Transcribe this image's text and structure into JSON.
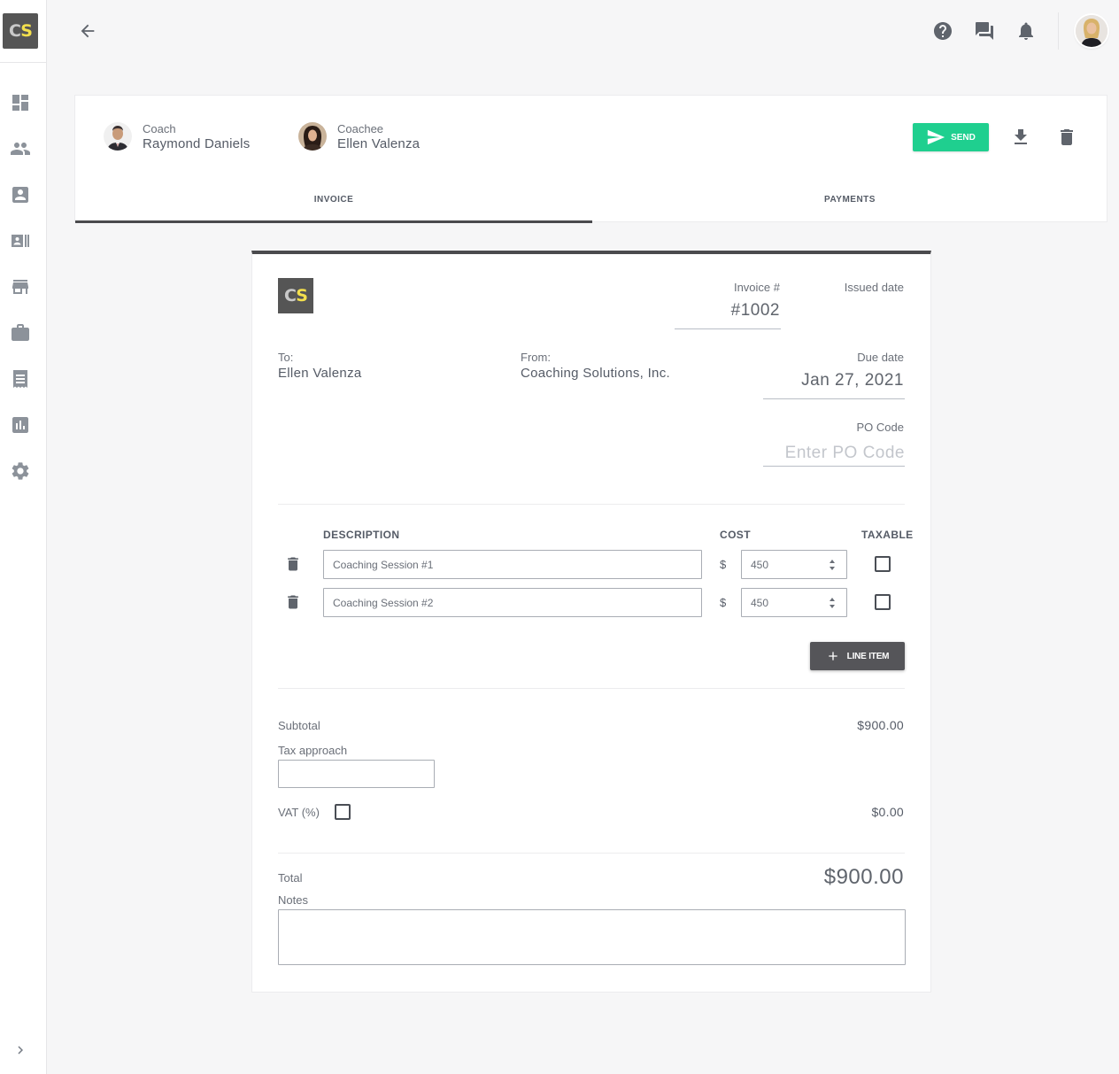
{
  "brand": {
    "logo_c": "C",
    "logo_s": "S",
    "colors": {
      "accent": "#1fcf8f",
      "logo_bg": "#555555",
      "logo_yellow": "#f4e04d"
    }
  },
  "sidebar": {
    "items": [
      {
        "icon": "dashboard-icon"
      },
      {
        "icon": "people-icon"
      },
      {
        "icon": "portrait-icon"
      },
      {
        "icon": "contacts-icon"
      },
      {
        "icon": "store-icon"
      },
      {
        "icon": "briefcase-icon"
      },
      {
        "icon": "receipt-icon"
      },
      {
        "icon": "chart-icon"
      },
      {
        "icon": "settings-icon"
      }
    ]
  },
  "topbar": {
    "icons": [
      "back-arrow-icon",
      "help-icon",
      "chat-icon",
      "notifications-icon"
    ]
  },
  "header": {
    "coach": {
      "role": "Coach",
      "name": "Raymond Daniels"
    },
    "coachee": {
      "role": "Coachee",
      "name": "Ellen Valenza"
    },
    "send_label": "SEND",
    "tabs": [
      {
        "label": "INVOICE",
        "active": true
      },
      {
        "label": "PAYMENTS",
        "active": false
      }
    ]
  },
  "invoice": {
    "invoice_no_label": "Invoice #",
    "invoice_no": "#1002",
    "issued_label": "Issued date",
    "issued_value": "",
    "to_label": "To:",
    "to_value": "Ellen Valenza",
    "from_label": "From:",
    "from_value": "Coaching Solutions, Inc.",
    "due_label": "Due date",
    "due_value": "Jan 27, 2021",
    "po_label": "PO Code",
    "po_placeholder": "Enter PO Code",
    "columns": {
      "description": "DESCRIPTION",
      "cost": "COST",
      "taxable": "TAXABLE"
    },
    "currency_symbol": "$",
    "items": [
      {
        "description": "Coaching Session #1",
        "cost": "450",
        "taxable": false
      },
      {
        "description": "Coaching Session #2",
        "cost": "450",
        "taxable": false
      }
    ],
    "add_line_label": "LINE ITEM",
    "subtotal_label": "Subtotal",
    "subtotal_value": "$900.00",
    "tax_approach_label": "Tax approach",
    "vat_label": "VAT (%)",
    "vat_value": "$0.00",
    "total_label": "Total",
    "total_value": "$900.00",
    "notes_label": "Notes"
  }
}
